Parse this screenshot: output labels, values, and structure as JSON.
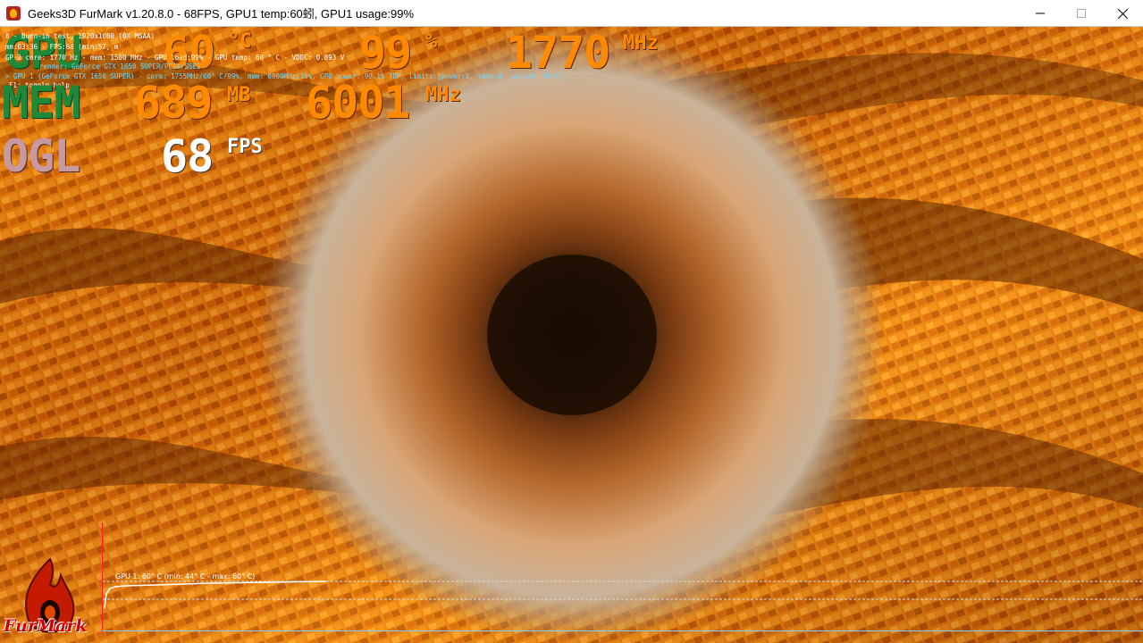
{
  "window": {
    "title": "Geeks3D FurMark v1.20.8.0 - 68FPS, GPU1 temp:60蚓, GPU1 usage:99%"
  },
  "hud": {
    "gpu_label": "GPU",
    "gpu_temp": "60",
    "gpu_temp_unit": "°C",
    "gpu_usage": "99",
    "gpu_usage_unit": "%",
    "gpu_clock": "1770",
    "gpu_clock_unit": "MHz",
    "mem_label": "MEM",
    "mem_used": "689",
    "mem_used_unit": "MB",
    "mem_clock": "6001",
    "mem_clock_unit": "MHz",
    "ogl_label": "OGL",
    "fps": "68",
    "fps_unit": "FPS"
  },
  "info_lines": {
    "line1": "8 - Burn-in test, 1920x1080 (0X MSAA)",
    "line2": "mm:03:36 - FPS:68 (min:57, m",
    "line3": "GP   2 core: 1770 Hz - mem: 1500 MHz - GPU load:99% - GPU temp: 60 ° C - VDDC: 0.893 V",
    "line4": "render: GeForce GTX 1650 SUPER/PCIe/SSE2",
    "line5": "> GPU 1 (GeForce GTX 1650 SUPER) - core: 1755MHz/60° C/99%, mem: 6000MHz/16%, GPU power: 98.1% TDP, limits:[power:1, temp:0, volt:0, OV:0]",
    "line6": "F1: toggle help"
  },
  "graph": {
    "label": "GPU 1: 60° C (min: 44° C - max: 60° C)"
  },
  "branding": {
    "logo_text": "FurMark",
    "logo_color": "#d40000"
  },
  "colors": {
    "hud_orange": "#ff8a00",
    "hud_green": "#1d8a3a",
    "graph_axis": "#7fd0ff"
  }
}
